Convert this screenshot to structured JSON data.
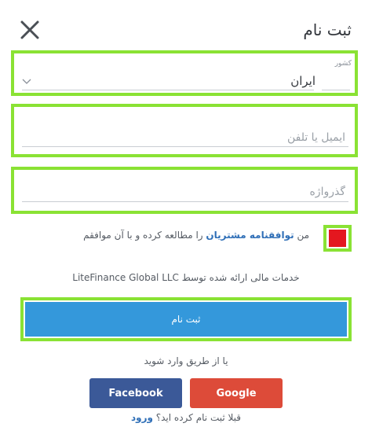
{
  "header": {
    "title": "ثبت نام",
    "close_icon": "close-icon"
  },
  "form": {
    "country": {
      "label": "کشور",
      "value": "ایران"
    },
    "email": {
      "placeholder": "ایمیل یا تلفن",
      "value": ""
    },
    "password": {
      "placeholder": "گذرواژه",
      "value": ""
    },
    "agreement": {
      "prefix": "من",
      "link": "توافقنامه مشتریان",
      "suffix": "را مطالعه کرده و با آن موافقم",
      "checkbox_color": "#e4171f"
    },
    "provider_text": "خدمات مالی ارائه شده توسط LiteFinance Global LLC",
    "submit_label": "ثبت نام"
  },
  "social": {
    "or_text": "یا از طریق وارد شوید",
    "facebook_label": "Facebook",
    "google_label": "Google",
    "facebook_color": "#3b5998",
    "google_color": "#dd4b39"
  },
  "footer": {
    "prompt": "قبلا ثبت نام کرده اید؟",
    "login_link": "ورود"
  },
  "colors": {
    "highlight": "#8ae234",
    "accent": "#3498db",
    "link": "#2f6fb7"
  }
}
